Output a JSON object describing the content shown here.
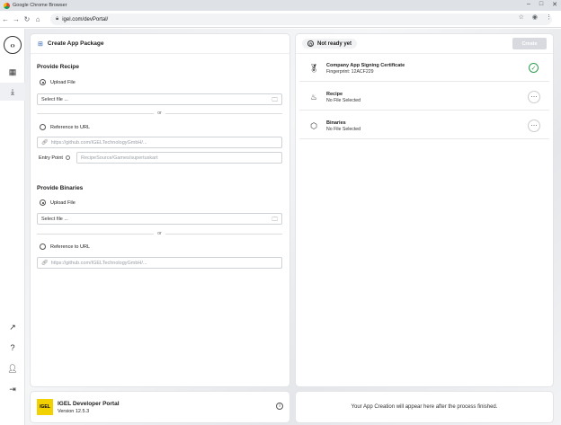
{
  "browser": {
    "title": "Google Chrome Browser",
    "url": "igel.com/devPortal/"
  },
  "left_panel": {
    "title": "Create App Package",
    "recipe": {
      "section_title": "Provide Recipe",
      "upload_label": "Upload File",
      "file_placeholder": "Select file ...",
      "or_text": "or",
      "reference_label": "Reference to URL",
      "url_value": "https://github.com/IGELTechnologyGmbH/...",
      "entry_point_label": "Entry Point",
      "entry_point_value": "RecipeSource/Games/supertuxkart"
    },
    "binaries": {
      "section_title": "Provide Binaries",
      "upload_label": "Upload File",
      "file_placeholder": "Select file ...",
      "or_text": "or",
      "reference_label": "Reference to URL",
      "url_value": "https://github.com/IGELTechnologyGmbH/..."
    }
  },
  "right_panel": {
    "status": "Not ready yet",
    "create_label": "Create",
    "items": [
      {
        "title": "Company App Signing Certificate",
        "sub": "Fingerprint: 12ACF229",
        "icon": "certificate-icon",
        "state": "ok"
      },
      {
        "title": "Recipe",
        "sub": "No File Selected",
        "icon": "chef-hat-icon",
        "state": "more"
      },
      {
        "title": "Binaries",
        "sub": "No File Selected",
        "icon": "box-icon",
        "state": "more"
      }
    ]
  },
  "footer": {
    "brand_name": "IGEL Developer Portal",
    "version": "Version 12.5.3",
    "logo_text": "IGEL",
    "message": "Your App Creation will appear here after the process finished."
  }
}
